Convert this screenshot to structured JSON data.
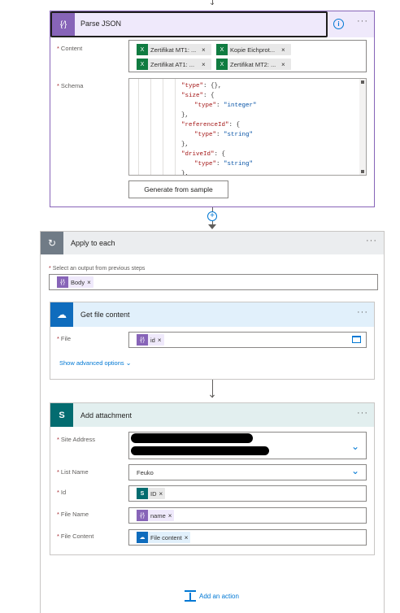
{
  "parse_json": {
    "title": "Parse JSON",
    "content_label": "Content",
    "content_tokens": [
      "Zertifikat MT1: ...",
      "Kopie Eichprot...",
      "Zertifikat AT1: ...",
      "Zertifikat MT2: ..."
    ],
    "schema_label": "Schema",
    "schema_lines": [
      {
        "indent": 0,
        "parts": [
          {
            "t": "\"type\"",
            "c": "key"
          },
          {
            "t": ": {},",
            "c": ""
          }
        ]
      },
      {
        "indent": 0,
        "parts": [
          {
            "t": "\"size\"",
            "c": "key"
          },
          {
            "t": ": {",
            "c": ""
          }
        ]
      },
      {
        "indent": 1,
        "parts": [
          {
            "t": "\"type\"",
            "c": "key"
          },
          {
            "t": ": ",
            "c": ""
          },
          {
            "t": "\"integer\"",
            "c": "str"
          }
        ]
      },
      {
        "indent": 0,
        "parts": [
          {
            "t": "},",
            "c": ""
          }
        ]
      },
      {
        "indent": 0,
        "parts": [
          {
            "t": "\"referenceId\"",
            "c": "key"
          },
          {
            "t": ": {",
            "c": ""
          }
        ]
      },
      {
        "indent": 1,
        "parts": [
          {
            "t": "\"type\"",
            "c": "key"
          },
          {
            "t": ": ",
            "c": ""
          },
          {
            "t": "\"string\"",
            "c": "str"
          }
        ]
      },
      {
        "indent": 0,
        "parts": [
          {
            "t": "},",
            "c": ""
          }
        ]
      },
      {
        "indent": 0,
        "parts": [
          {
            "t": "\"driveId\"",
            "c": "key"
          },
          {
            "t": ": {",
            "c": ""
          }
        ]
      },
      {
        "indent": 1,
        "parts": [
          {
            "t": "\"type\"",
            "c": "key"
          },
          {
            "t": ": ",
            "c": ""
          },
          {
            "t": "\"string\"",
            "c": "str"
          }
        ]
      },
      {
        "indent": 0,
        "parts": [
          {
            "t": "},",
            "c": ""
          }
        ]
      }
    ],
    "generate_button": "Generate from sample"
  },
  "apply_each": {
    "title": "Apply to each",
    "select_label": "Select an output from previous steps",
    "token": "Body"
  },
  "get_file": {
    "title": "Get file content",
    "file_label": "File",
    "token": "id",
    "advanced": "Show advanced options"
  },
  "add_attachment": {
    "title": "Add attachment",
    "site_label": "Site Address",
    "list_label": "List Name",
    "list_value": "Feuko",
    "id_label": "Id",
    "id_token": "ID",
    "filename_label": "File Name",
    "filename_token": "name",
    "filecontent_label": "File Content",
    "filecontent_token": "File content"
  },
  "footer": {
    "add_action": "Add an action"
  },
  "colors": {
    "parse_accent": "#8764b8",
    "parse_header_bg": "#efe9fb",
    "apply_header_bg": "#ebedef",
    "getfile_header_bg": "#e1f0fb",
    "attach_header_bg": "#e2efef",
    "onedrive_blue": "#0f6cbd",
    "sharepoint_teal": "#036c70",
    "excel_green": "#107c41"
  }
}
